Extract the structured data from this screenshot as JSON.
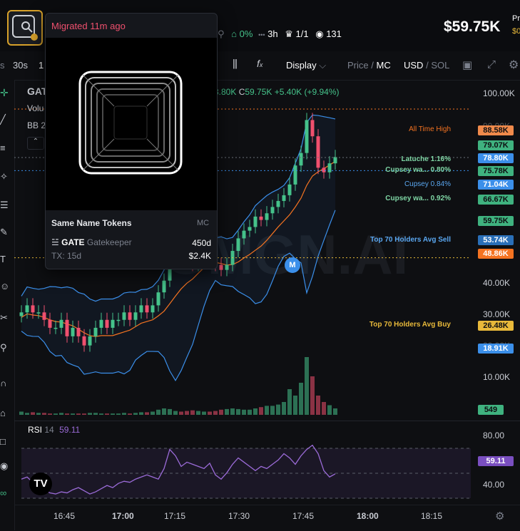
{
  "header": {
    "token_ticker_partial": "GATE",
    "top_pct": "0%",
    "age": "3h",
    "holders_ratio": "1/1",
    "watchers": "131",
    "price": "$59.75K",
    "pr_label_partial": "Pr",
    "pr_value_partial": "$0"
  },
  "popup": {
    "migrated": "Migrated 11m ago",
    "same_name_title": "Same Name Tokens",
    "mc_label": "MC",
    "row_ticker": "GATE",
    "row_name": "Gatekeeper",
    "row_age": "450d",
    "row_tx": "TX: 15d",
    "row_mc": "$2.4K"
  },
  "toolbar": {
    "tf_s": "s",
    "tf_30s": "30s",
    "tf_1": "1",
    "display": "Display",
    "price": "Price",
    "slash": "/",
    "mc": "MC",
    "usd": "USD",
    "sol": "SOL"
  },
  "legend": {
    "symbol": "GAT",
    "vol": "Volu",
    "bb": "BB 2",
    "low_partial": "3.80K",
    "close_label": "C",
    "close": "59.75K",
    "change": "+5.40K (+9.94%)"
  },
  "lines": {
    "ath": "All Time High",
    "latuche": "Latuche 1.16%",
    "cupsey1": "Cupsey wa... 0.80%",
    "cupsey2": "Cupsey 0.84%",
    "cupsey3": "Cupsey wa... 0.92%",
    "top70sell": "Top 70 Holders Avg Sell",
    "top70buy": "Top 70 Holders Avg Buy"
  },
  "pills": {
    "ath": "88.58K",
    "p1": "79.07K",
    "latuche": "78.80K",
    "cupsey1": "75.78K",
    "cupsey2": "71.04K",
    "cupsey3": "66.67K",
    "current": "59.75K",
    "sell": "53.74K",
    "orange": "48.86K",
    "buy": "26.48K",
    "bblow": "18.91K",
    "vol": "549",
    "rsi": "59.11"
  },
  "yaxis": [
    "100.00K",
    "90.00K",
    "40.00K",
    "30.00K",
    "20.00K",
    "10.00K"
  ],
  "rsi": {
    "label": "RSI",
    "period": "14",
    "value": "59.11",
    "levels": [
      "80.00",
      "40.00"
    ]
  },
  "xaxis": [
    "16:45",
    "17:00",
    "17:15",
    "17:30",
    "17:45",
    "18:00",
    "18:15"
  ],
  "watermark": "GMGN.AI",
  "marker": "M",
  "colors": {
    "up": "#45c28a",
    "down": "#f0506e",
    "orange": "#f47321",
    "blue": "#3b8fea",
    "gold": "#e8b93a"
  },
  "chart_data": {
    "type": "candlestick",
    "title": "",
    "xlabel": "",
    "ylabel": "",
    "x_ticks": [
      "16:45",
      "17:00",
      "17:15",
      "17:30",
      "17:45",
      "18:00",
      "18:15"
    ],
    "y_ticks": [
      "10.00K",
      "20.00K",
      "30.00K",
      "40.00K",
      "100.00K"
    ],
    "candles_close_k": [
      17,
      18,
      17,
      17,
      16,
      15,
      15,
      16,
      14,
      15,
      14,
      13,
      14,
      15,
      16,
      15,
      16,
      16,
      17,
      16,
      17,
      18,
      17,
      18,
      20,
      22,
      26,
      28,
      27,
      26,
      25,
      27,
      28,
      27,
      25,
      24,
      25,
      28,
      31,
      33,
      34,
      37,
      36,
      38,
      40,
      42,
      44,
      48,
      56,
      62,
      81,
      71,
      55,
      53,
      57,
      60
    ],
    "volume_relative": [
      5,
      3,
      4,
      3,
      3,
      2,
      2,
      3,
      2,
      2,
      2,
      2,
      3,
      3,
      2,
      2,
      2,
      2,
      3,
      2,
      3,
      4,
      4,
      5,
      8,
      10,
      9,
      6,
      5,
      6,
      7,
      6,
      5,
      5,
      6,
      8,
      9,
      10,
      9,
      8,
      8,
      10,
      12,
      14,
      14,
      16,
      20,
      40,
      30,
      50,
      90,
      60,
      30,
      20,
      15,
      10
    ]
  }
}
